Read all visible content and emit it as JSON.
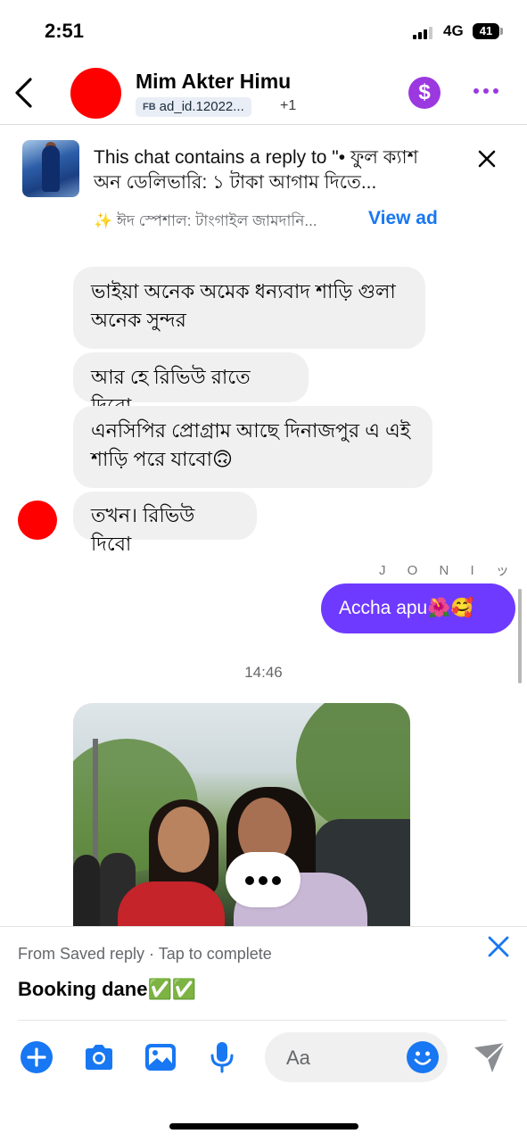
{
  "status_bar": {
    "time": "2:51",
    "network": "4G",
    "battery": "41"
  },
  "header": {
    "contact_name": "Mim Akter Himu",
    "ad_id_badge": "FB",
    "ad_id": "ad_id.12022...",
    "extra_count": "+1",
    "accent_color": "#9b38e0",
    "icons": [
      "back-chevron-icon",
      "dollar-icon",
      "more-dots-icon"
    ]
  },
  "ad_banner": {
    "text": "This chat contains a reply to \"• ফুল ক্যাশ অন ডেলিভারি: ১ টাকা আগাম দিতে...",
    "subtitle": "✨ ঈদ স্পেশাল: টাংগাইল জামদানি...",
    "view_ad_label": "View ad",
    "link_color": "#1877f2"
  },
  "messages": {
    "incoming": [
      "ভাইয়া অনেক অমেক ধন্যবাদ শাড়ি গুলা অনেক সুন্দর",
      "আর হে রিভিউ রাতে দিবো",
      "এনসিপির প্রোগ্রাম আছে দিনাজপুর এ এই শাড়ি পরে যাবো🙃",
      "তখন। রিভিউ দিবো"
    ],
    "sender_label": "J O N I ッ",
    "outgoing": "Accha apu🌺🥰",
    "outgoing_color": "#6e3aff",
    "timestamp": "14:46"
  },
  "saved_reply": {
    "hint": "From Saved reply · Tap to complete",
    "text": "Booking dane✅✅"
  },
  "composer": {
    "placeholder": "Aa",
    "icons": [
      "plus-icon",
      "camera-icon",
      "gallery-icon",
      "microphone-icon",
      "emoji-icon",
      "send-icon"
    ]
  }
}
